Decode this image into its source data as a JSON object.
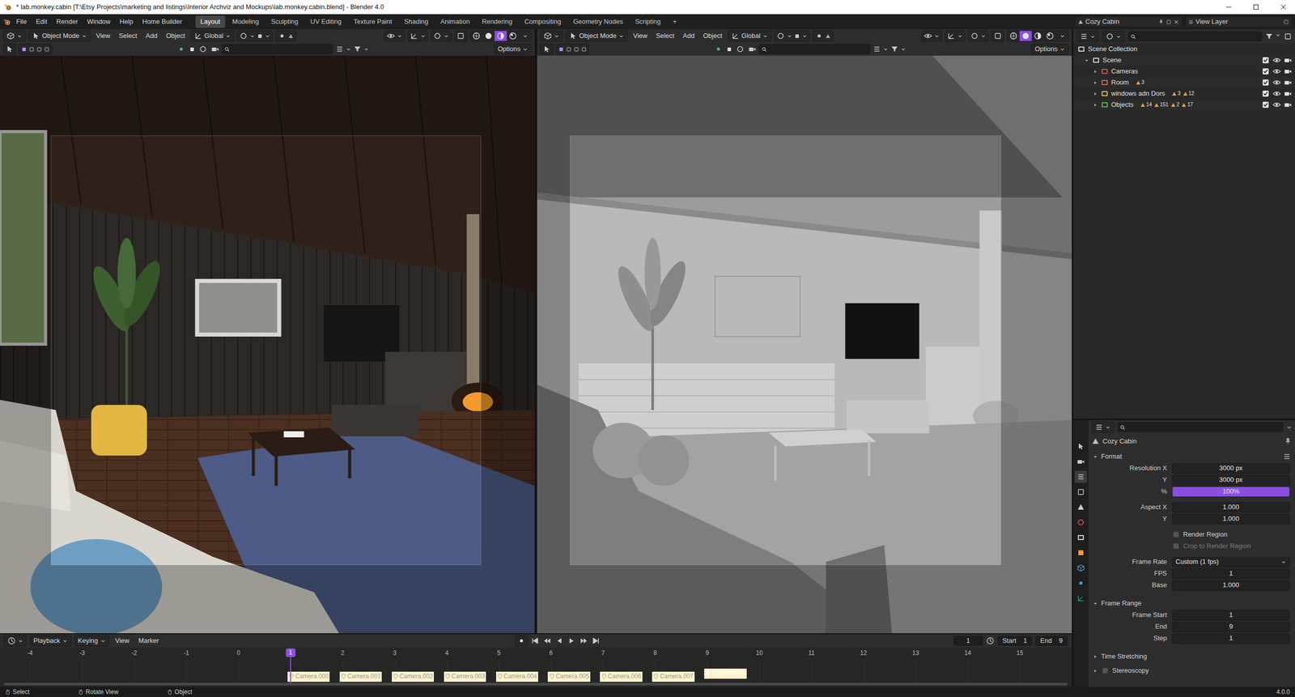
{
  "window": {
    "title": "* lab.monkey.cabin [T:\\Etsy Projects\\marketing and listings\\Interior Archviz and Mockups\\lab.monkey.cabin.blend] - Blender 4.0"
  },
  "menus": [
    "File",
    "Edit",
    "Render",
    "Window",
    "Help",
    "Home Builder"
  ],
  "workspaces": [
    {
      "label": "Layout",
      "selected": true
    },
    {
      "label": "Modeling",
      "selected": false
    },
    {
      "label": "Sculpting",
      "selected": false
    },
    {
      "label": "UV Editing",
      "selected": false
    },
    {
      "label": "Texture Paint",
      "selected": false
    },
    {
      "label": "Shading",
      "selected": false
    },
    {
      "label": "Animation",
      "selected": false
    },
    {
      "label": "Rendering",
      "selected": false
    },
    {
      "label": "Compositing",
      "selected": false
    },
    {
      "label": "Geometry Nodes",
      "selected": false
    },
    {
      "label": "Scripting",
      "selected": false
    }
  ],
  "add_workspace": "+",
  "scene": "Cozy Cabin",
  "view_layer": "View Layer",
  "viewports": [
    {
      "kind": "material",
      "mode": "Object Mode",
      "menus": [
        "View",
        "Select",
        "Add",
        "Object"
      ],
      "orientation": "Global",
      "options": "Options",
      "shading": [
        {
          "selected": false
        },
        {
          "selected": false
        },
        {
          "selected": true
        },
        {
          "selected": false
        }
      ]
    },
    {
      "kind": "solid",
      "mode": "Object Mode",
      "menus": [
        "View",
        "Select",
        "Add",
        "Object"
      ],
      "orientation": "Global",
      "options": "Options",
      "shading": [
        {
          "selected": false
        },
        {
          "selected": true
        },
        {
          "selected": false
        },
        {
          "selected": false
        }
      ]
    }
  ],
  "outliner": {
    "root": "Scene Collection",
    "scene": "Scene",
    "scene_expanded": true,
    "collections": [
      {
        "label": "Cameras",
        "expanded": false,
        "color": "#d84b4b",
        "counts": [],
        "checked": true,
        "visible": true,
        "renderable": true
      },
      {
        "label": "Room",
        "expanded": false,
        "color": "#e0604a",
        "counts": [
          "3"
        ],
        "checked": true,
        "visible": true,
        "renderable": true
      },
      {
        "label": "windows adn Dors",
        "expanded": false,
        "color": "#e0c040",
        "counts": [
          "3",
          "12"
        ],
        "checked": true,
        "visible": true,
        "renderable": true
      },
      {
        "label": "Objects",
        "expanded": false,
        "color": "#5fb84a",
        "counts": [
          "14",
          "151",
          "2",
          "17"
        ],
        "checked": true,
        "visible": true,
        "renderable": true
      }
    ]
  },
  "properties": {
    "title": "Cozy Cabin",
    "tabs": [
      {
        "selected": false
      },
      {
        "selected": false
      },
      {
        "selected": true
      },
      {
        "selected": false
      },
      {
        "selected": false
      },
      {
        "selected": false
      },
      {
        "selected": false
      },
      {
        "selected": false
      },
      {
        "selected": false
      },
      {
        "selected": false
      },
      {
        "selected": false
      }
    ],
    "sections": [
      {
        "label": "Format",
        "expanded": true,
        "groups": [
          [
            {
              "kind": "field",
              "label": "Resolution X",
              "value": "3000 px"
            },
            {
              "kind": "field",
              "label": "Y",
              "value": "3000 px"
            },
            {
              "kind": "slider",
              "label": "%",
              "value": "100%",
              "level": 1
            }
          ],
          [
            {
              "kind": "field",
              "label": "Aspect X",
              "value": "1.000"
            },
            {
              "kind": "field",
              "label": "Y",
              "value": "1.000"
            }
          ],
          [
            {
              "kind": "check",
              "label": "Render Region",
              "checked": false,
              "disabled": false
            },
            {
              "kind": "check",
              "label": "Crop to Render Region",
              "checked": false,
              "disabled": true
            }
          ],
          [
            {
              "kind": "dropdown",
              "label": "Frame Rate",
              "value": "Custom (1 fps)"
            },
            {
              "kind": "field",
              "label": "FPS",
              "value": "1"
            },
            {
              "kind": "field",
              "label": "Base",
              "value": "1.000"
            }
          ]
        ]
      },
      {
        "label": "Frame Range",
        "expanded": true,
        "groups": [
          [
            {
              "kind": "field",
              "label": "Frame Start",
              "value": "1"
            },
            {
              "kind": "field",
              "label": "End",
              "value": "9"
            },
            {
              "kind": "field",
              "label": "Step",
              "value": "1"
            }
          ]
        ]
      },
      {
        "label": "Time Stretching",
        "expanded": false,
        "groups": []
      },
      {
        "label": "Stereoscopy",
        "expanded": false,
        "checkbox": false,
        "groups": []
      }
    ]
  },
  "timeline": {
    "menus": [
      "Playback",
      "Keying",
      "View",
      "Marker"
    ],
    "current": "1",
    "start_label": "Start",
    "start": "1",
    "end_label": "End",
    "end": "9",
    "playhead": "1",
    "ticks": [
      "-4",
      "-3",
      "-2",
      "-1",
      "0",
      "1",
      "2",
      "3",
      "4",
      "5",
      "6",
      "7",
      "8",
      "9",
      "10",
      "11",
      "12",
      "13",
      "14",
      "15"
    ],
    "markers": [
      {
        "label": "Camera.000",
        "frame": 1,
        "selected": false
      },
      {
        "label": "Camera.001",
        "frame": 2,
        "selected": false
      },
      {
        "label": "Camera.002",
        "frame": 3,
        "selected": false
      },
      {
        "label": "Camera.003",
        "frame": 4,
        "selected": false
      },
      {
        "label": "Camera.004",
        "frame": 5,
        "selected": false
      },
      {
        "label": "Camera.005",
        "frame": 6,
        "selected": false
      },
      {
        "label": "Camera.006",
        "frame": 7,
        "selected": false
      },
      {
        "label": "Camera.007",
        "frame": 8,
        "selected": false
      },
      {
        "label": "Camera.008",
        "frame": 9,
        "selected": true
      }
    ]
  },
  "status": {
    "items": [
      "Select",
      "Rotate View",
      "Object"
    ],
    "version": "4.0.0"
  }
}
